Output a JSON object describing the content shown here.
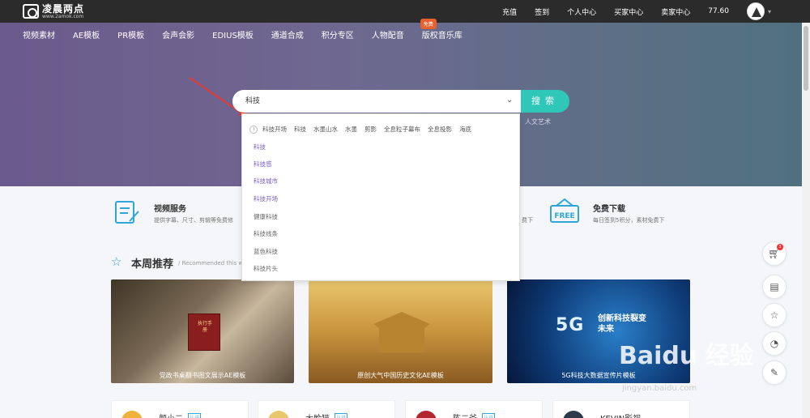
{
  "header": {
    "logo_title": "凌晨两点",
    "logo_sub": "www.2amok.com",
    "links": [
      "充值",
      "签到",
      "个人中心",
      "买家中心",
      "卖家中心",
      "77.60"
    ]
  },
  "nav": {
    "items": [
      "视频素材",
      "AE模板",
      "PR模板",
      "会声会影",
      "EDIUS模板",
      "通道合成",
      "积分专区",
      "人物配音",
      "版权音乐库"
    ],
    "badge": "免费"
  },
  "search": {
    "value": "科技",
    "button": "搜索",
    "hot_word": "人文艺术"
  },
  "dropdown": {
    "history": [
      "科技开场",
      "科技",
      "水墨山水",
      "水墨",
      "剪影",
      "全息粒子幕布",
      "全息投影",
      "海底"
    ],
    "suggestions": [
      "科技",
      "科技感",
      "科技城市",
      "科技开场",
      "健康科技",
      "科技线条",
      "蓝色科技",
      "科技片头"
    ]
  },
  "features": {
    "service_title": "视频服务",
    "service_desc": "提供字幕、尺寸、剪辑等免费修",
    "service_desc_tail": "费下",
    "download_title": "免费下载",
    "download_desc": "每日签到5积分，素材免费下",
    "free_text": "FREE"
  },
  "weekly": {
    "title": "本周推荐",
    "subtitle": "/ Recommended this w",
    "cards": [
      "党政书桌翻书图文展示AE模板",
      "原创大气中国历史文化AE模板",
      "5G科技大数据宣传片模板"
    ],
    "card1_book": "执行手册",
    "card3_big": "5G",
    "card3_small": "创新科技裂变未来"
  },
  "authors": [
    {
      "name": "颜小二",
      "tag": "认证",
      "color": "#f0b23a"
    },
    {
      "name": "大脸猫",
      "tag": "认证",
      "color": "#e8c66a"
    },
    {
      "name": "陈二爷",
      "tag": "认证",
      "color": "#b3262d"
    },
    {
      "name": "KEVIN影视",
      "tag": "认证",
      "color": "#2d3a4a"
    }
  ],
  "side_tools": {
    "cart_count": "3"
  },
  "watermark": {
    "main": "Baidu 经验",
    "url": "jingyan.baidu.com"
  },
  "colors": {
    "accent": "#2ec7b8",
    "link_purple": "#7b5fc1",
    "badge_orange": "#e8612c"
  }
}
